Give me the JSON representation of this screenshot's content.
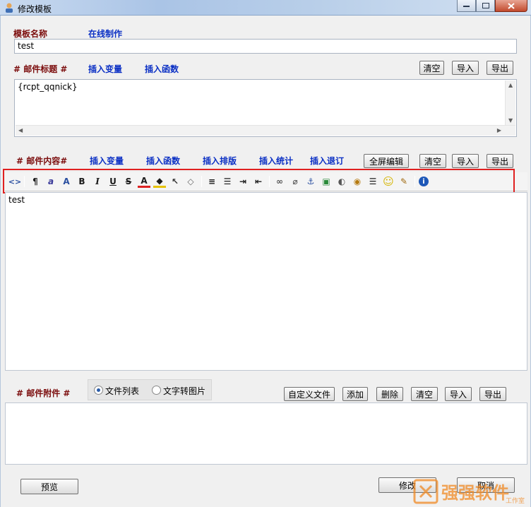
{
  "window": {
    "title": "修改模板"
  },
  "template_name": {
    "label": "模板名称",
    "online_make": "在线制作",
    "value": "test"
  },
  "subject": {
    "label": "# 邮件标题 #",
    "insert_var": "插入变量",
    "insert_func": "插入函数",
    "value": "{rcpt_qqnick}",
    "buttons": {
      "clear": "清空",
      "import": "导入",
      "export": "导出"
    }
  },
  "content": {
    "label": "# 邮件内容#",
    "insert_var": "插入变量",
    "insert_func": "插入函数",
    "insert_layout": "插入排版",
    "insert_stats": "插入统计",
    "insert_unsub": "插入退订",
    "buttons": {
      "fullscreen": "全屏编辑",
      "clear": "清空",
      "import": "导入",
      "export": "导出"
    },
    "body_text": "test"
  },
  "attachments": {
    "label": "# 邮件附件 #",
    "radio_file_list": "文件列表",
    "radio_text_to_image": "文字转图片",
    "selected": "文件列表",
    "buttons": {
      "custom_file": "自定义文件",
      "add": "添加",
      "delete": "删除",
      "clear": "清空",
      "import": "导入",
      "export": "导出"
    }
  },
  "footer": {
    "preview": "预览",
    "modify": "修改",
    "cancel": "取消"
  },
  "watermark": {
    "text": "强强软件",
    "sub": "工作室"
  },
  "colors": {
    "label_red": "#7b0c0c",
    "link_blue": "#0a2fc4",
    "highlight": "#e02020"
  },
  "toolbar_icons": [
    "source-code-icon",
    "paragraph-format-icon",
    "font-family-icon",
    "font-size-icon",
    "bold-icon",
    "italic-icon",
    "underline-icon",
    "strikethrough-icon",
    "text-color-icon",
    "background-color-icon",
    "select-all-icon",
    "eraser-icon",
    "align-icon",
    "list-icon",
    "indent-icon",
    "outdent-icon",
    "link-icon",
    "unlink-icon",
    "anchor-icon",
    "image-icon",
    "flash-icon",
    "media-icon",
    "horizontal-rule-icon",
    "emoticon-icon",
    "edit-icon",
    "about-icon"
  ]
}
